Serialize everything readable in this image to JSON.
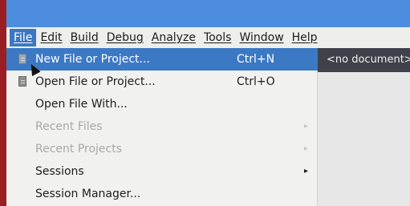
{
  "menubar": {
    "items": [
      {
        "label": "File"
      },
      {
        "label": "Edit"
      },
      {
        "label": "Build"
      },
      {
        "label": "Debug"
      },
      {
        "label": "Analyze"
      },
      {
        "label": "Tools"
      },
      {
        "label": "Window"
      },
      {
        "label": "Help"
      }
    ]
  },
  "file_menu": {
    "items": [
      {
        "label": "New File or Project...",
        "shortcut": "Ctrl+N",
        "icon": "document-icon"
      },
      {
        "label": "Open File or Project...",
        "shortcut": "Ctrl+O",
        "icon": "document-icon"
      },
      {
        "label": "Open File With..."
      },
      {
        "label": "Recent Files",
        "submenu_arrow": "▸"
      },
      {
        "label": "Recent Projects",
        "submenu_arrow": "▸"
      },
      {
        "label": "Sessions",
        "submenu_arrow": "▸"
      },
      {
        "label": "Session Manager..."
      }
    ]
  },
  "editor": {
    "tab_label": "<no document>"
  },
  "colors": {
    "window_border": "#9a1f24",
    "titlebar": "#4d8ddf",
    "highlight": "#3b79c4"
  }
}
